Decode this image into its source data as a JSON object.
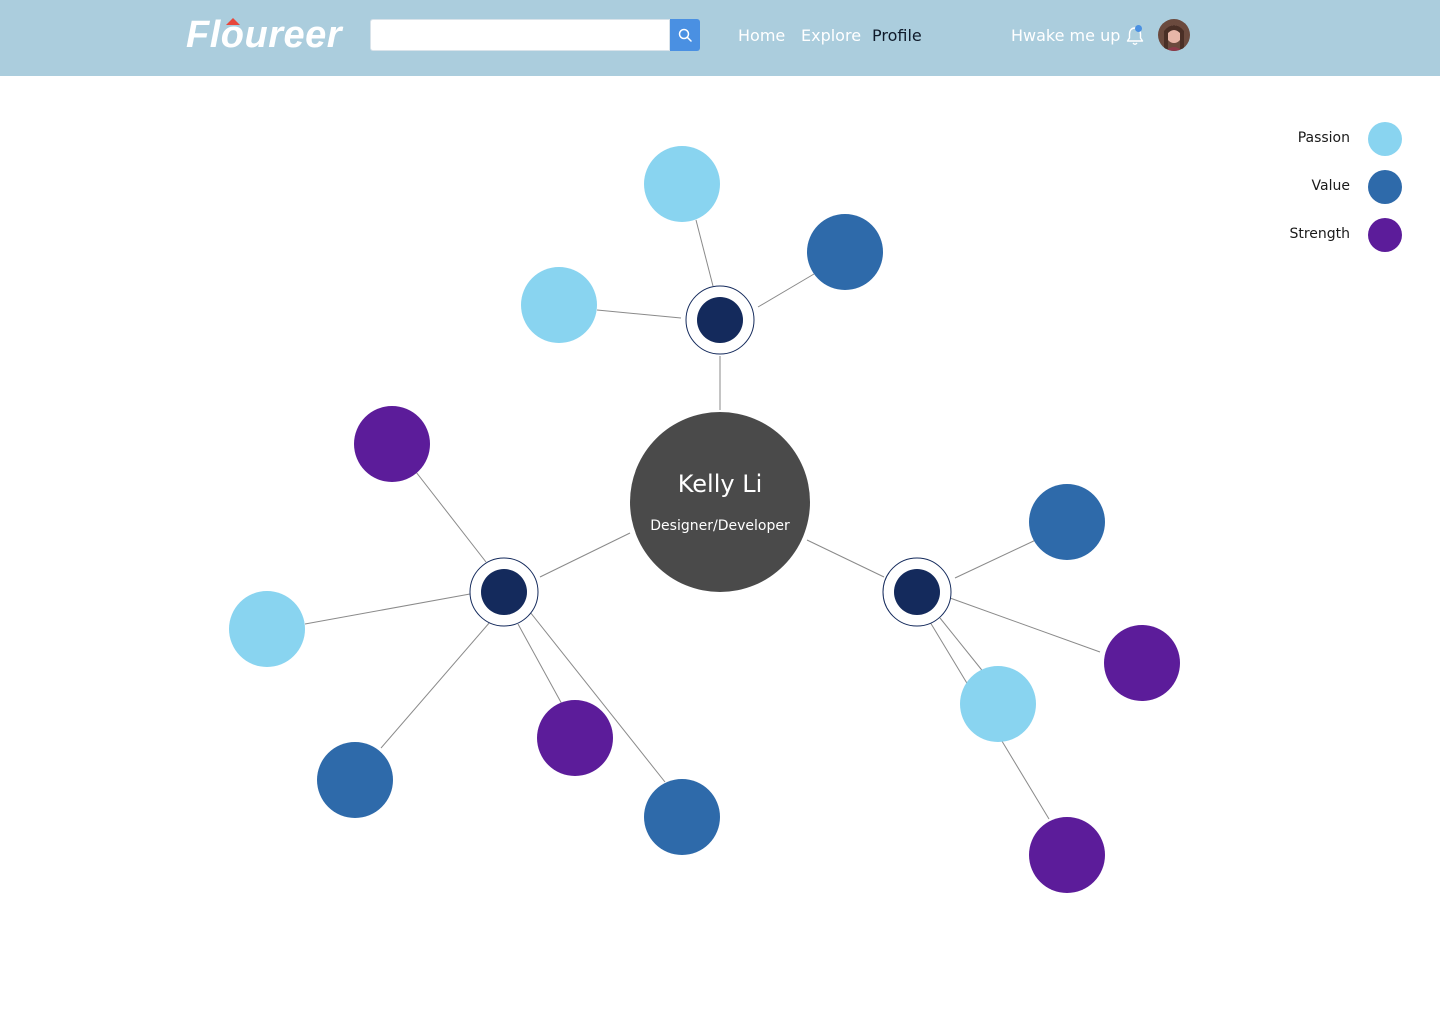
{
  "header": {
    "logo": "Floureer",
    "search": {
      "placeholder": "",
      "value": ""
    },
    "nav": {
      "home": "Home",
      "explore": "Explore",
      "profile": "Profile"
    },
    "hwake": "Hwake me up"
  },
  "legend": {
    "items": [
      {
        "label": "Passion",
        "color": "#89d4f0"
      },
      {
        "label": "Value",
        "color": "#2e6aaa"
      },
      {
        "label": "Strength",
        "color": "#5c1c9a"
      }
    ]
  },
  "profile": {
    "name": "Kelly Li",
    "title": "Designer/Developer"
  },
  "colors": {
    "header_bg": "#abcddd",
    "accent": "#4a90e2",
    "hub": "#142a5c",
    "center": "#4a4a4a"
  }
}
